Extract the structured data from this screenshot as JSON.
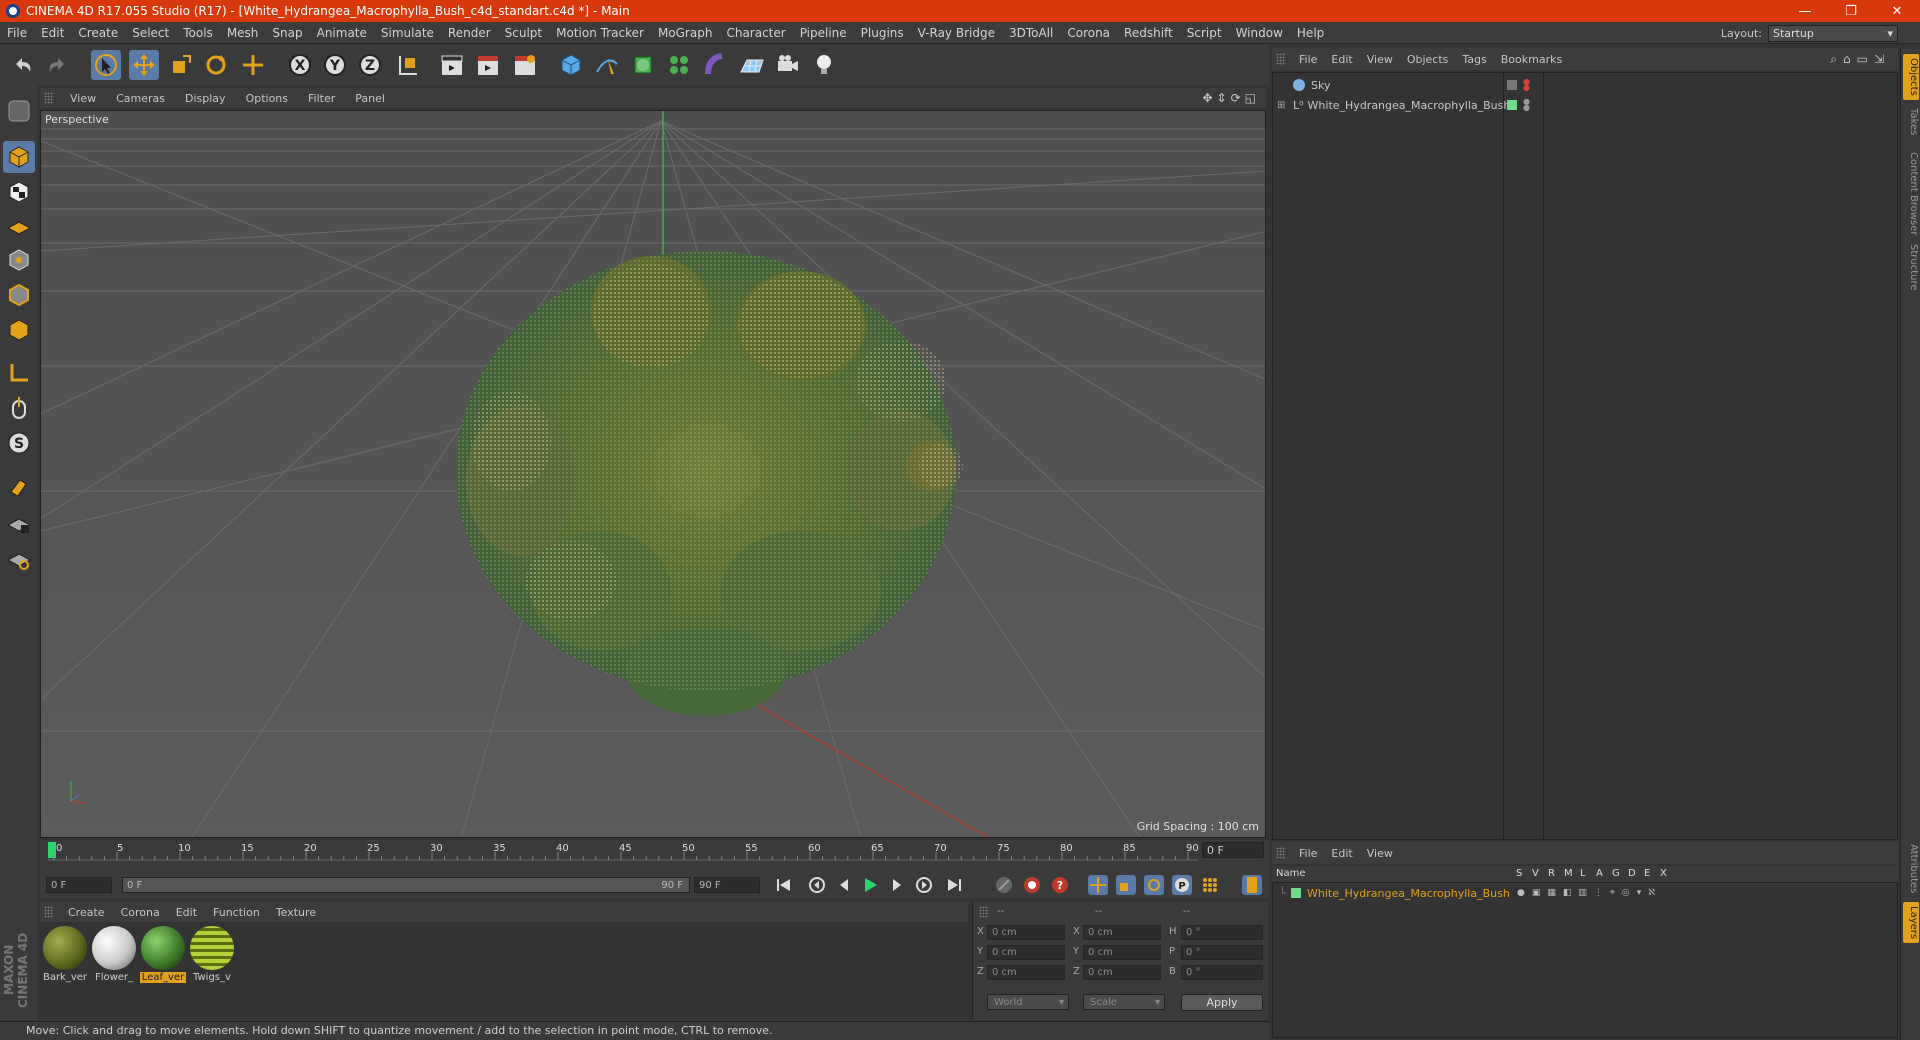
{
  "titlebar": {
    "title": "CINEMA 4D R17.055 Studio (R17) - [White_Hydrangea_Macrophylla_Bush_c4d_standart.c4d *] - Main",
    "minimize": "—",
    "restore": "❐",
    "close": "✕"
  },
  "menubar": {
    "items": [
      "File",
      "Edit",
      "Create",
      "Select",
      "Tools",
      "Mesh",
      "Snap",
      "Animate",
      "Simulate",
      "Render",
      "Sculpt",
      "Motion Tracker",
      "MoGraph",
      "Character",
      "Pipeline",
      "Plugins",
      "V-Ray Bridge",
      "3DToAll",
      "Corona",
      "Redshift",
      "Script",
      "Window",
      "Help"
    ],
    "layout_label": "Layout:",
    "layout_value": "Startup"
  },
  "viewport": {
    "menu": [
      "View",
      "Cameras",
      "Display",
      "Options",
      "Filter",
      "Panel"
    ],
    "camera_label": "Perspective",
    "grid_spacing": "Grid Spacing : 100 cm"
  },
  "timeline": {
    "ticks": [
      "0",
      "5",
      "10",
      "15",
      "20",
      "25",
      "30",
      "35",
      "40",
      "45",
      "50",
      "55",
      "60",
      "65",
      "70",
      "75",
      "80",
      "85",
      "90"
    ],
    "current_frame": "0 F",
    "start_field": "0 F",
    "range_start": "0 F",
    "range_end": "90 F",
    "end_field": "90 F"
  },
  "materials": {
    "menu": [
      "Create",
      "Corona",
      "Edit",
      "Function",
      "Texture"
    ],
    "items": [
      {
        "name": "Bark_ver",
        "color": "#5f6a1e",
        "active": false
      },
      {
        "name": "Flower_",
        "color": "#d8d8d8",
        "active": false
      },
      {
        "name": "Leaf_ver",
        "color": "#3e7a2a",
        "active": true
      },
      {
        "name": "Twigs_v",
        "color": "#8ea62a",
        "active": false
      }
    ]
  },
  "coords": {
    "headers": [
      "--",
      "--",
      "--"
    ],
    "rows": [
      {
        "a": "X",
        "pos": "0 cm",
        "b": "X",
        "size": "0 cm",
        "c": "H",
        "rot": "0 °"
      },
      {
        "a": "Y",
        "pos": "0 cm",
        "b": "Y",
        "size": "0 cm",
        "c": "P",
        "rot": "0 °"
      },
      {
        "a": "Z",
        "pos": "0 cm",
        "b": "Z",
        "size": "0 cm",
        "c": "B",
        "rot": "0 °"
      }
    ],
    "space": "World",
    "mode": "Scale",
    "apply": "Apply"
  },
  "statusbar": {
    "text": "Move: Click and drag to move elements. Hold down SHIFT to quantize movement / add to the selection in point mode, CTRL to remove."
  },
  "objects": {
    "menu": [
      "File",
      "Edit",
      "View",
      "Objects",
      "Tags",
      "Bookmarks"
    ],
    "items": [
      {
        "name": "Sky"
      },
      {
        "name": "White_Hydrangea_Macrophylla_Bush"
      }
    ]
  },
  "layers": {
    "menu": [
      "File",
      "Edit",
      "View"
    ],
    "header_name": "Name",
    "columns": [
      "S",
      "V",
      "R",
      "M",
      "L",
      "A",
      "G",
      "D",
      "E",
      "X"
    ],
    "items": [
      {
        "name": "White_Hydrangea_Macrophylla_Bush"
      }
    ]
  },
  "righttabs": [
    "Objects",
    "Takes",
    "Content Browser",
    "Structure",
    "Attributes",
    "Layers"
  ],
  "logo": "MAXON CINEMA 4D",
  "colors": {
    "titlebar": "#d8390c",
    "selection": "#5a7aa8",
    "active_orange": "#e2a21b",
    "layer_green": "#6fdc8c"
  }
}
